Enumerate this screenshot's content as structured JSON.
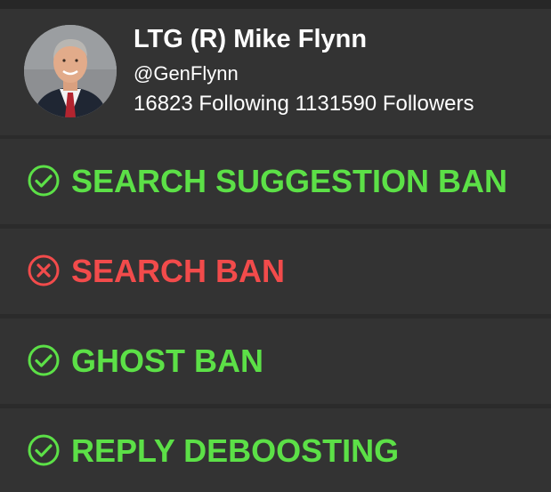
{
  "profile": {
    "display_name": "LTG (R) Mike Flynn",
    "handle": "@GenFlynn",
    "following_count": "16823",
    "following_label": "Following",
    "followers_count": "1131590",
    "followers_label": "Followers"
  },
  "checks": [
    {
      "label": "SEARCH SUGGESTION BAN",
      "status": "pass",
      "icon": "check-circle-icon"
    },
    {
      "label": "SEARCH BAN",
      "status": "fail",
      "icon": "x-circle-icon"
    },
    {
      "label": "GHOST BAN",
      "status": "pass",
      "icon": "check-circle-icon"
    },
    {
      "label": "REPLY DEBOOSTING",
      "status": "pass",
      "icon": "check-circle-icon"
    }
  ],
  "colors": {
    "pass": "#5ce047",
    "fail": "#f24b4b",
    "background": "#2b2b2b",
    "panel": "#333333",
    "text": "#ffffff"
  }
}
